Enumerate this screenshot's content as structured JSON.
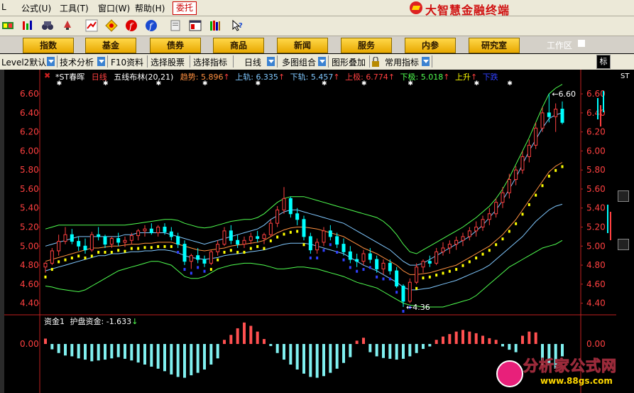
{
  "menu": [
    "公式(U)",
    "工具(T)",
    "窗口(W)",
    "帮助(H)"
  ],
  "menu_prefix": "L",
  "weituo": "委托",
  "brand": "大智慧金融终端",
  "nav": [
    "指数",
    "基金",
    "债券",
    "商品",
    "新闻",
    "服务",
    "内参",
    "研究室"
  ],
  "workarea": "工作区",
  "tabs": [
    "Level2默认",
    "技术分析",
    "F10资料",
    "选择股票",
    "选择指标",
    "日线",
    "多图组合",
    "图形叠加",
    "常用指标"
  ],
  "biao": "标",
  "right_label": "ST",
  "header": {
    "stock": "*ST春晖",
    "period": "日线",
    "indicator": "五线布林(20,21)",
    "trend_label": "趋势",
    "trend_value": "5.896",
    "upper_label": "上轨",
    "upper_value": "6.335",
    "lower_label": "下轨",
    "lower_value": "5.457",
    "upmost_label": "上极",
    "upmost_value": "6.774",
    "lowmost_label": "下极",
    "lowmost_value": "5.018",
    "rise_label": "上升",
    "fall_label": "下跌"
  },
  "y_ticks": [
    "6.60",
    "6.40",
    "6.20",
    "6.00",
    "5.80",
    "5.60",
    "5.40",
    "5.20",
    "5.00",
    "4.80",
    "4.60",
    "4.40"
  ],
  "high_label": "6.60",
  "low_label": "4.36",
  "sub": {
    "title": "资金1",
    "label": "护盘资金:",
    "value": "-1.633",
    "zero_label": "0.00"
  },
  "watermark": {
    "title": "分析家公式网",
    "url": "www.88gs.com"
  },
  "colors": {
    "up": "#ff4040",
    "down": "#00ffff",
    "rise_marker": "#ffff00",
    "fall_marker": "#3040ff",
    "band_outer": "#50ff50",
    "band_mid": "#ff9040",
    "band_inner": "#80c8ff",
    "axis": "#c02020"
  },
  "chart_data": {
    "type": "candlestick",
    "title": "*ST春晖 日线",
    "ylim": [
      4.3,
      6.75
    ],
    "ohlc": [
      [
        4.78,
        4.83,
        4.72,
        4.82
      ],
      [
        4.82,
        4.98,
        4.8,
        4.95
      ],
      [
        4.95,
        5.12,
        4.9,
        5.05
      ],
      [
        5.05,
        5.2,
        5.02,
        5.12
      ],
      [
        5.12,
        5.18,
        5.02,
        5.05
      ],
      [
        5.05,
        5.1,
        4.95,
        5.0
      ],
      [
        5.0,
        5.08,
        4.92,
        4.96
      ],
      [
        4.96,
        5.15,
        4.94,
        5.12
      ],
      [
        5.12,
        5.2,
        5.06,
        5.1
      ],
      [
        5.1,
        5.12,
        4.98,
        5.02
      ],
      [
        5.02,
        5.1,
        4.98,
        5.08
      ],
      [
        5.08,
        5.14,
        5.0,
        5.04
      ],
      [
        5.04,
        5.1,
        4.99,
        5.06
      ],
      [
        5.06,
        5.14,
        5.02,
        5.11
      ],
      [
        5.11,
        5.18,
        5.06,
        5.16
      ],
      [
        5.16,
        5.22,
        5.1,
        5.18
      ],
      [
        5.18,
        5.24,
        5.12,
        5.14
      ],
      [
        5.14,
        5.22,
        5.1,
        5.2
      ],
      [
        5.2,
        5.24,
        5.12,
        5.15
      ],
      [
        5.15,
        5.2,
        5.06,
        5.1
      ],
      [
        5.1,
        5.14,
        4.98,
        5.02
      ],
      [
        5.02,
        5.06,
        4.8,
        4.84
      ],
      [
        4.84,
        4.92,
        4.76,
        4.9
      ],
      [
        4.9,
        4.98,
        4.82,
        4.86
      ],
      [
        4.86,
        4.9,
        4.78,
        4.82
      ],
      [
        4.82,
        4.96,
        4.8,
        4.94
      ],
      [
        4.94,
        5.06,
        4.9,
        5.02
      ],
      [
        5.02,
        5.2,
        5.0,
        5.16
      ],
      [
        5.16,
        5.22,
        5.02,
        5.06
      ],
      [
        5.06,
        5.12,
        4.98,
        5.02
      ],
      [
        5.02,
        5.1,
        4.98,
        5.06
      ],
      [
        5.06,
        5.14,
        5.02,
        5.1
      ],
      [
        5.1,
        5.16,
        5.04,
        5.08
      ],
      [
        5.08,
        5.14,
        5.02,
        5.12
      ],
      [
        5.12,
        5.28,
        5.1,
        5.24
      ],
      [
        5.24,
        5.42,
        5.2,
        5.38
      ],
      [
        5.38,
        5.62,
        5.34,
        5.5
      ],
      [
        5.5,
        5.52,
        5.3,
        5.34
      ],
      [
        5.34,
        5.4,
        5.22,
        5.28
      ],
      [
        5.28,
        5.32,
        5.06,
        5.1
      ],
      [
        5.1,
        5.14,
        4.92,
        4.96
      ],
      [
        4.96,
        5.08,
        4.92,
        5.04
      ],
      [
        5.04,
        5.2,
        5.0,
        5.16
      ],
      [
        5.16,
        5.22,
        5.06,
        5.1
      ],
      [
        5.1,
        5.14,
        4.98,
        5.02
      ],
      [
        5.02,
        5.08,
        4.9,
        4.94
      ],
      [
        4.94,
        5.0,
        4.82,
        4.86
      ],
      [
        4.86,
        4.92,
        4.78,
        4.84
      ],
      [
        4.84,
        4.96,
        4.8,
        4.92
      ],
      [
        4.92,
        4.98,
        4.82,
        4.86
      ],
      [
        4.86,
        4.9,
        4.72,
        4.76
      ],
      [
        4.76,
        4.86,
        4.7,
        4.82
      ],
      [
        4.82,
        4.86,
        4.7,
        4.74
      ],
      [
        4.74,
        4.78,
        4.56,
        4.58
      ],
      [
        4.58,
        4.6,
        4.36,
        4.42
      ],
      [
        4.42,
        4.66,
        4.4,
        4.62
      ],
      [
        4.62,
        4.82,
        4.6,
        4.78
      ],
      [
        4.78,
        4.86,
        4.72,
        4.84
      ],
      [
        4.84,
        4.9,
        4.78,
        4.82
      ],
      [
        4.82,
        4.98,
        4.8,
        4.94
      ],
      [
        4.94,
        5.04,
        4.9,
        4.98
      ],
      [
        4.98,
        5.06,
        4.92,
        5.02
      ],
      [
        5.02,
        5.1,
        4.96,
        5.06
      ],
      [
        5.06,
        5.14,
        5.0,
        5.1
      ],
      [
        5.1,
        5.2,
        5.06,
        5.16
      ],
      [
        5.16,
        5.26,
        5.1,
        5.2
      ],
      [
        5.2,
        5.32,
        5.16,
        5.28
      ],
      [
        5.28,
        5.4,
        5.22,
        5.34
      ],
      [
        5.34,
        5.5,
        5.3,
        5.46
      ],
      [
        5.46,
        5.62,
        5.4,
        5.56
      ],
      [
        5.56,
        5.76,
        5.5,
        5.7
      ],
      [
        5.7,
        5.84,
        5.64,
        5.8
      ],
      [
        5.8,
        6.0,
        5.76,
        5.94
      ],
      [
        5.94,
        6.12,
        5.88,
        6.06
      ],
      [
        6.06,
        6.3,
        6.02,
        6.24
      ],
      [
        6.24,
        6.46,
        6.2,
        6.4
      ],
      [
        6.4,
        6.6,
        6.3,
        6.36
      ],
      [
        6.36,
        6.5,
        6.2,
        6.44
      ],
      [
        6.44,
        6.52,
        6.28,
        6.3
      ]
    ],
    "bands": {
      "upper_outer": [
        5.18,
        5.2,
        5.22,
        5.22,
        5.22,
        5.22,
        5.22,
        5.22,
        5.22,
        5.22,
        5.22,
        5.22,
        5.22,
        5.23,
        5.24,
        5.25,
        5.26,
        5.27,
        5.28,
        5.28,
        5.27,
        5.24,
        5.22,
        5.2,
        5.19,
        5.2,
        5.22,
        5.24,
        5.26,
        5.27,
        5.28,
        5.28,
        5.3,
        5.34,
        5.4,
        5.46,
        5.5,
        5.52,
        5.52,
        5.52,
        5.5,
        5.48,
        5.46,
        5.44,
        5.42,
        5.4,
        5.38,
        5.36,
        5.34,
        5.32,
        5.3,
        5.26,
        5.2,
        5.12,
        5.02,
        4.94,
        4.92,
        4.96,
        5.0,
        5.04,
        5.08,
        5.12,
        5.16,
        5.2,
        5.25,
        5.3,
        5.36,
        5.42,
        5.5,
        5.6,
        5.72,
        5.86,
        6.0,
        6.14,
        6.3,
        6.46,
        6.6,
        6.66,
        6.7
      ],
      "upper_inner": [
        5.0,
        5.02,
        5.04,
        5.06,
        5.08,
        5.1,
        5.1,
        5.1,
        5.1,
        5.1,
        5.1,
        5.1,
        5.12,
        5.12,
        5.14,
        5.14,
        5.14,
        5.14,
        5.14,
        5.12,
        5.1,
        5.08,
        5.06,
        5.04,
        5.02,
        5.04,
        5.06,
        5.08,
        5.1,
        5.12,
        5.14,
        5.16,
        5.18,
        5.22,
        5.28,
        5.32,
        5.36,
        5.38,
        5.38,
        5.36,
        5.34,
        5.32,
        5.3,
        5.28,
        5.26,
        5.24,
        5.2,
        5.16,
        5.12,
        5.08,
        5.04,
        5.0,
        4.96,
        4.9,
        4.84,
        4.8,
        4.8,
        4.82,
        4.86,
        4.9,
        4.94,
        4.98,
        5.02,
        5.06,
        5.1,
        5.16,
        5.22,
        5.3,
        5.38,
        5.48,
        5.6,
        5.72,
        5.86,
        6.0,
        6.12,
        6.24,
        6.34,
        6.38,
        6.4
      ],
      "mid": [
        4.84,
        4.86,
        4.88,
        4.9,
        4.92,
        4.94,
        4.96,
        4.98,
        4.98,
        4.99,
        5.0,
        5.0,
        5.01,
        5.02,
        5.02,
        5.03,
        5.03,
        5.04,
        5.04,
        5.04,
        5.02,
        5.0,
        4.98,
        4.96,
        4.95,
        4.96,
        4.97,
        4.98,
        5.0,
        5.01,
        5.02,
        5.03,
        5.04,
        5.06,
        5.1,
        5.14,
        5.17,
        5.19,
        5.2,
        5.2,
        5.19,
        5.18,
        5.16,
        5.14,
        5.12,
        5.1,
        5.06,
        5.02,
        4.98,
        4.95,
        4.92,
        4.88,
        4.84,
        4.8,
        4.74,
        4.7,
        4.7,
        4.71,
        4.72,
        4.74,
        4.76,
        4.78,
        4.8,
        4.84,
        4.88,
        4.92,
        4.96,
        5.0,
        5.06,
        5.12,
        5.2,
        5.28,
        5.38,
        5.48,
        5.58,
        5.68,
        5.78,
        5.84,
        5.88
      ],
      "lower_inner": [
        4.74,
        4.76,
        4.78,
        4.8,
        4.82,
        4.84,
        4.86,
        4.88,
        4.9,
        4.9,
        4.92,
        4.92,
        4.93,
        4.94,
        4.94,
        4.95,
        4.95,
        4.96,
        4.96,
        4.95,
        4.93,
        4.9,
        4.88,
        4.87,
        4.86,
        4.87,
        4.88,
        4.9,
        4.91,
        4.92,
        4.93,
        4.94,
        4.95,
        4.96,
        4.98,
        5.0,
        5.02,
        5.03,
        5.03,
        5.03,
        5.02,
        5.0,
        4.98,
        4.96,
        4.94,
        4.92,
        4.88,
        4.84,
        4.8,
        4.77,
        4.74,
        4.7,
        4.66,
        4.62,
        4.57,
        4.54,
        4.54,
        4.55,
        4.56,
        4.58,
        4.6,
        4.62,
        4.64,
        4.67,
        4.7,
        4.73,
        4.76,
        4.8,
        4.86,
        4.92,
        4.98,
        5.04,
        5.1,
        5.18,
        5.26,
        5.32,
        5.38,
        5.42,
        5.44
      ],
      "lower_outer": [
        4.58,
        4.57,
        4.55,
        4.54,
        4.53,
        4.52,
        4.54,
        4.58,
        4.62,
        4.66,
        4.7,
        4.74,
        4.76,
        4.78,
        4.8,
        4.82,
        4.84,
        4.84,
        4.82,
        4.8,
        4.74,
        4.68,
        4.66,
        4.66,
        4.68,
        4.72,
        4.76,
        4.78,
        4.8,
        4.81,
        4.82,
        4.82,
        4.81,
        4.8,
        4.78,
        4.76,
        4.76,
        4.77,
        4.78,
        4.78,
        4.77,
        4.76,
        4.74,
        4.72,
        4.7,
        4.68,
        4.65,
        4.62,
        4.6,
        4.58,
        4.56,
        4.52,
        4.48,
        4.44,
        4.4,
        4.38,
        4.37,
        4.36,
        4.36,
        4.36,
        4.36,
        4.38,
        4.4,
        4.42,
        4.44,
        4.48,
        4.54,
        4.6,
        4.66,
        4.72,
        4.78,
        4.82,
        4.86,
        4.9,
        4.94,
        4.98,
        5.0,
        5.02,
        5.06
      ]
    },
    "money_flow": [
      0.13,
      -0.13,
      -0.22,
      -0.28,
      -0.3,
      -0.35,
      -0.38,
      -0.42,
      -0.4,
      -0.38,
      -0.35,
      -0.32,
      -0.36,
      -0.4,
      -0.45,
      -0.5,
      -0.55,
      -0.6,
      -0.66,
      -0.74,
      -0.8,
      -0.82,
      -0.76,
      -0.7,
      -0.62,
      -0.5,
      -0.35,
      0.1,
      0.22,
      0.38,
      0.52,
      0.44,
      0.3,
      0.12,
      -0.05,
      -0.22,
      -0.38,
      -0.5,
      -0.62,
      -0.72,
      -0.8,
      -0.82,
      -0.78,
      -0.7,
      -0.6,
      -0.46,
      -0.32,
      0.08,
      0.15,
      -0.2,
      -0.3,
      -0.34,
      -0.36,
      -0.38,
      -0.36,
      -0.3,
      -0.22,
      -0.12,
      -0.06,
      0.1,
      0.18,
      0.24,
      0.3,
      0.34,
      0.3,
      0.26,
      0.2,
      0.14,
      0.1,
      -0.06,
      -0.14,
      -0.2,
      0.2,
      0.3,
      0.28,
      -0.4,
      -0.52,
      -0.6,
      -0.3
    ]
  }
}
